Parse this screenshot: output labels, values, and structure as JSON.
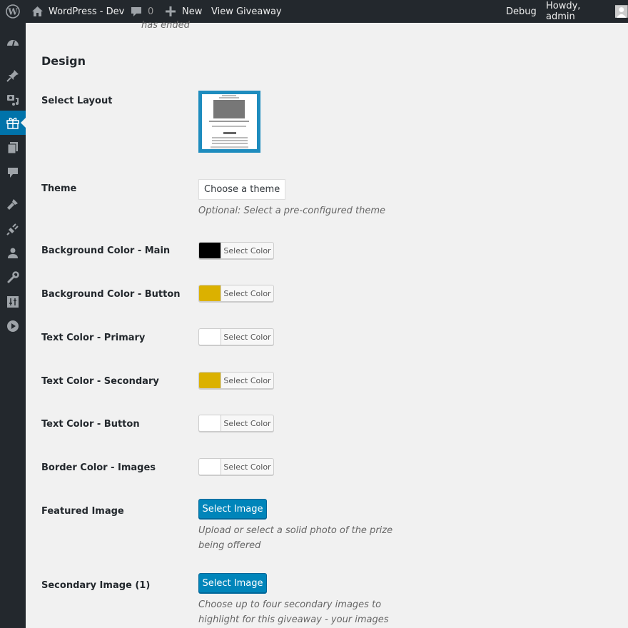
{
  "adminbar": {
    "site_name": "WordPress - Dev",
    "comments_count": "0",
    "new_label": "New",
    "view_label": "View Giveaway",
    "debug_label": "Debug",
    "howdy_label": "Howdy, admin"
  },
  "sidebar": {
    "items": [
      {
        "icon": "dashboard-icon"
      },
      {
        "icon": "pin-icon"
      },
      {
        "icon": "media-icon"
      },
      {
        "icon": "gift-icon",
        "active": true
      },
      {
        "icon": "pages-icon"
      },
      {
        "icon": "comments-icon"
      },
      {
        "icon": "appearance-icon"
      },
      {
        "icon": "plugins-icon"
      },
      {
        "icon": "users-icon"
      },
      {
        "icon": "tools-icon"
      },
      {
        "icon": "settings-icon"
      },
      {
        "icon": "collapse-play-icon"
      }
    ]
  },
  "content": {
    "ended_text": "has ended",
    "section_title": "Design",
    "layout_label": "Select Layout",
    "theme_label": "Theme",
    "theme_button": "Choose a theme",
    "theme_description": "Optional: Select a pre-configured theme",
    "colors": [
      {
        "label": "Background Color - Main",
        "button": "Select Color",
        "value": "#000000"
      },
      {
        "label": "Background Color - Button",
        "button": "Select Color",
        "value": "#dbb100"
      },
      {
        "label": "Text Color - Primary",
        "button": "Select Color",
        "value": "#ffffff"
      },
      {
        "label": "Text Color - Secondary",
        "button": "Select Color",
        "value": "#dbb100"
      },
      {
        "label": "Text Color - Button",
        "button": "Select Color",
        "value": "#ffffff"
      },
      {
        "label": "Border Color - Images",
        "button": "Select Color",
        "value": "#ffffff"
      }
    ],
    "featured_label": "Featured Image",
    "featured_button": "Select Image",
    "featured_description": "Upload or select a solid photo of the prize being offered",
    "secondary_label": "Secondary Image (1)",
    "secondary_button": "Select Image",
    "secondary_description": "Choose up to four secondary images to highlight for this giveaway - your images"
  }
}
